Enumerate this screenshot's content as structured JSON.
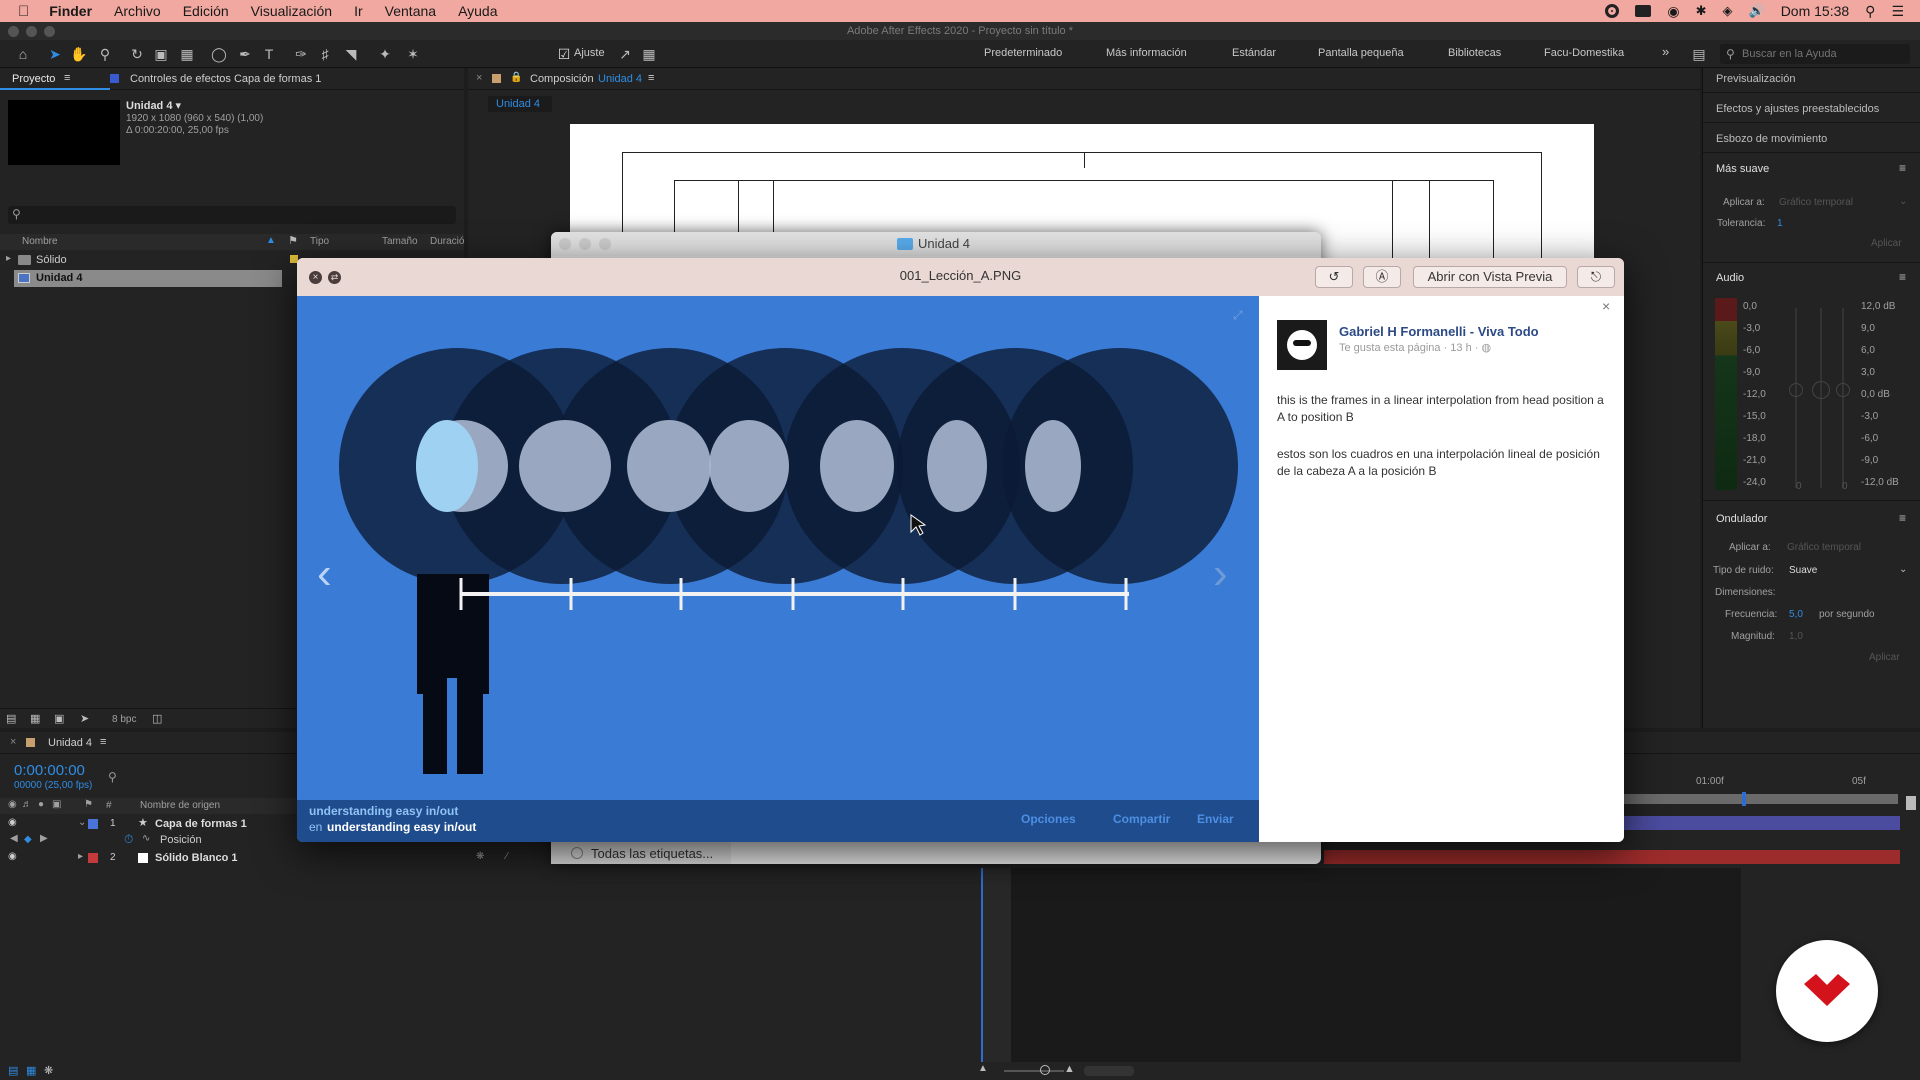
{
  "menubar": {
    "app": "Finder",
    "items": [
      "Archivo",
      "Edición",
      "Visualización",
      "Ir",
      "Ventana",
      "Ayuda"
    ],
    "clock": "Dom 15:38"
  },
  "ae": {
    "window_title": "Adobe After Effects 2020 - Proyecto sin título *",
    "snap_label": "Ajuste",
    "workspaces": [
      "Predeterminado",
      "Más información",
      "Estándar",
      "Pantalla pequeña",
      "Bibliotecas",
      "Facu-Domestika"
    ],
    "help_search_placeholder": "Buscar en la Ayuda"
  },
  "project": {
    "tab": "Proyecto",
    "effects_tab": "Controles de efectos Capa de formas 1",
    "item_name": "Unidad 4 ▾",
    "item_res": "1920 x 1080  (960 x 540) (1,00)",
    "item_dur": "Δ 0:00:20:00, 25,00 fps",
    "columns": [
      "Nombre",
      "Tipo",
      "Tamaño",
      "Duració"
    ],
    "rows": [
      "Sólido",
      "Unidad 4"
    ],
    "bpc": "8 bpc"
  },
  "composition": {
    "tab_prefix": "Composición",
    "tab_name": "Unidad 4",
    "subtab": "Unidad 4"
  },
  "right_panel": {
    "items": [
      "Previsualización",
      "Efectos y ajustes preestablecidos",
      "Esbozo de movimiento"
    ],
    "smoother_title": "Más suave",
    "apply_to_label": "Aplicar a:",
    "apply_to_value": "Gráfico temporal",
    "tolerance_label": "Tolerancia:",
    "tolerance_value": "1",
    "apply_btn": "Aplicar",
    "audio_title": "Audio",
    "audio_left": [
      "0,0",
      "-3,0",
      "-6,0",
      "-9,0",
      "-12,0",
      "-15,0",
      "-18,0",
      "-21,0",
      "-24,0"
    ],
    "audio_right": [
      "12,0 dB",
      "9,0",
      "6,0",
      "3,0",
      "0,0 dB",
      "-3,0",
      "-6,0",
      "-9,0",
      "-12,0 dB"
    ],
    "audio_bottom": [
      "0",
      "0"
    ],
    "wiggler_title": "Ondulador",
    "noise_label": "Tipo de ruido:",
    "noise_value": "Suave",
    "dims_label": "Dimensiones:",
    "freq_label": "Frecuencia:",
    "freq_value": "5,0",
    "freq_unit": "por segundo",
    "mag_label": "Magnitud:",
    "mag_value": "1,0",
    "apply_btn2": "Aplicar"
  },
  "timeline": {
    "tab": "Unidad 4",
    "timecode": "0:00:00:00",
    "frames": "00000 (25,00 fps)",
    "col_source": "Nombre de origen",
    "col_num": "#",
    "layers": [
      {
        "num": "1",
        "name": "Capa de formas 1"
      },
      {
        "num": "2",
        "name": "Sólido Blanco 1"
      }
    ],
    "prop": "Posición",
    "ruler": [
      "01:00f",
      "05f"
    ]
  },
  "finder": {
    "title": "Unidad 4",
    "tags": "Todas las etiquetas..."
  },
  "quicklook": {
    "filename": "001_Lección_A.PNG",
    "open_with": "Abrir con Vista Previa"
  },
  "fb": {
    "page_name": "Gabriel H Formanelli - Viva Todo",
    "meta": "Te gusta esta página · 13 h · ◍",
    "post_en": "this is the frames in a linear interpolation from head position a A to position B",
    "post_es": "estos son los cuadros en una interpolación lineal de posición de la cabeza A a la posición B",
    "album_title": "understanding easy in/out",
    "album_sub_prefix": "en",
    "album_sub": "understanding easy in/out",
    "actions": [
      "Opciones",
      "Compartir",
      "Enviar"
    ]
  },
  "colors": {
    "menubar": "#f0a8a0",
    "fb_blue": "#3a7bd5",
    "accent_red": "#d4121b",
    "ae_blue": "#2f8de4"
  }
}
